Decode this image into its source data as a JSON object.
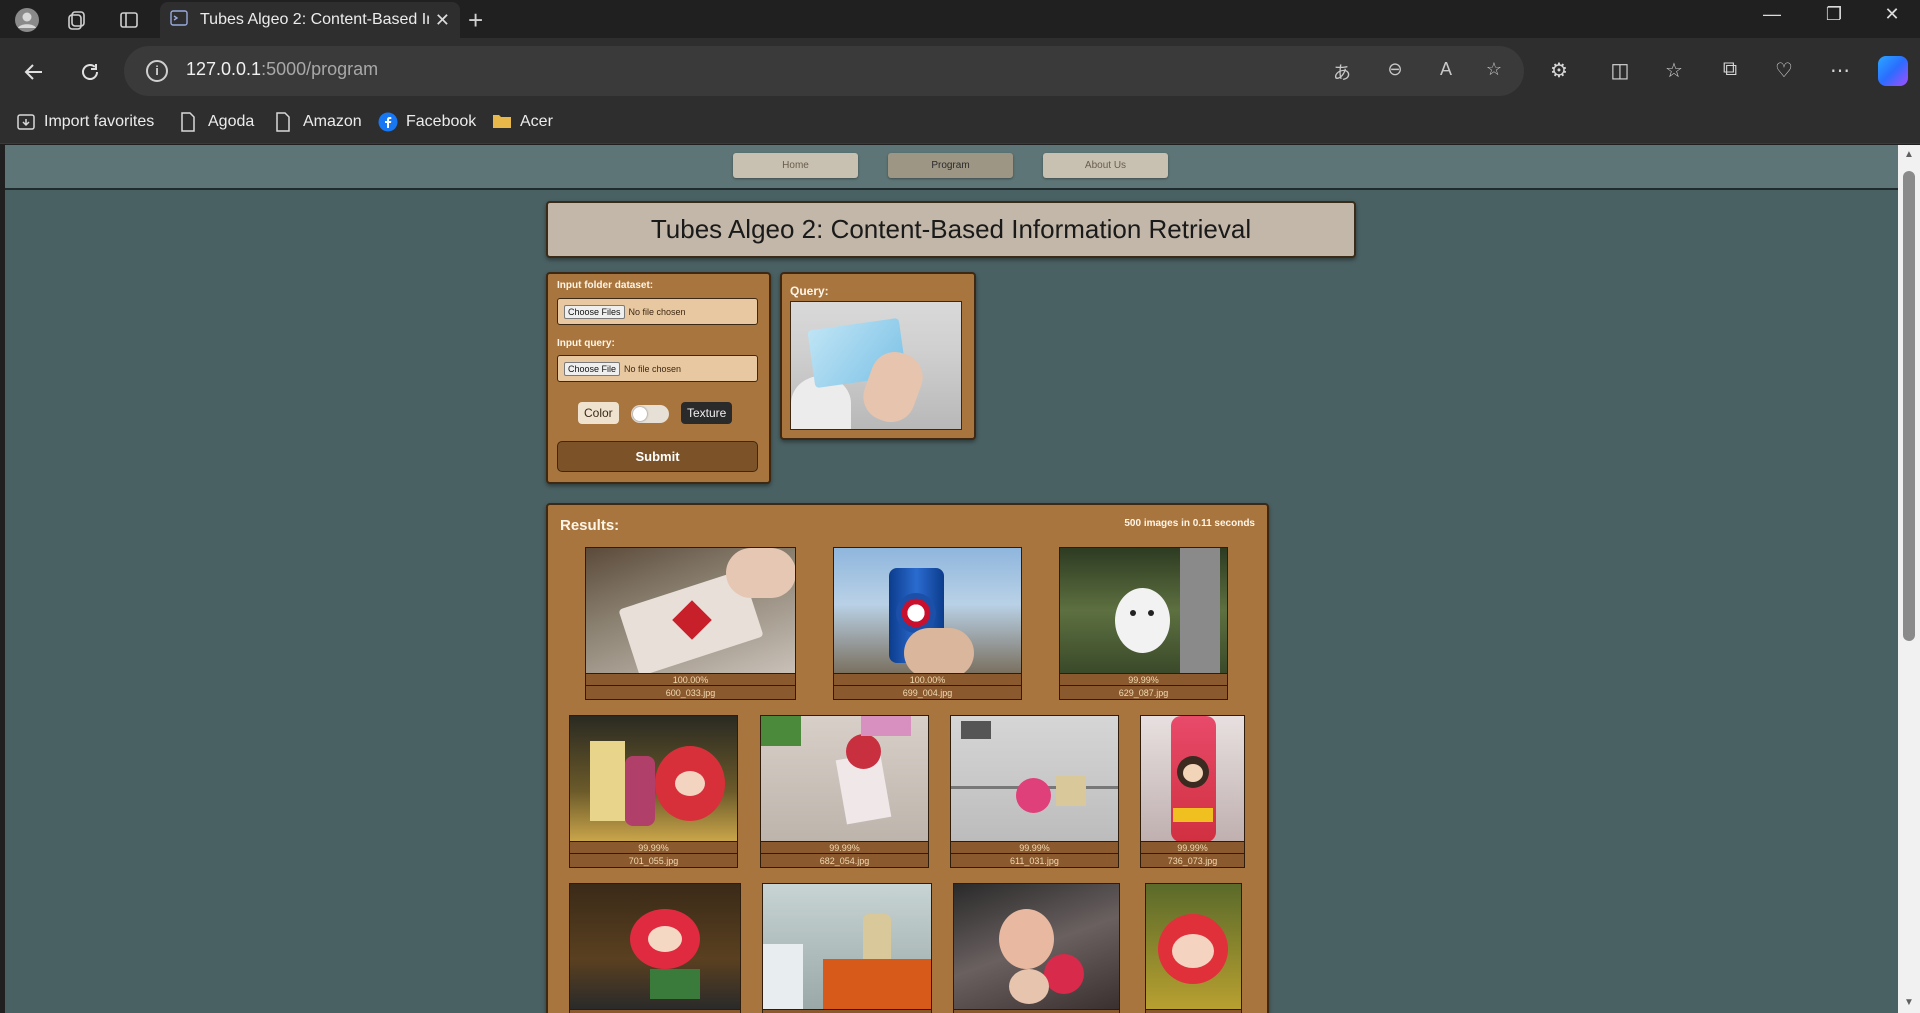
{
  "browser": {
    "tab_title": "Tubes Algeo 2: Content-Based In",
    "url_host": "127.0.0.1",
    "url_path": ":5000/program",
    "bookmarks": [
      "Import favorites",
      "Agoda",
      "Amazon",
      "Facebook",
      "Acer"
    ]
  },
  "site": {
    "nav": [
      "Home",
      "Program",
      "About Us"
    ],
    "active_nav": "Program",
    "title": "Tubes Algeo 2: Content-Based Information Retrieval"
  },
  "form": {
    "dataset_label": "Input folder dataset:",
    "dataset_button": "Choose Files",
    "dataset_status": "No file chosen",
    "query_label": "Input query:",
    "query_button": "Choose File",
    "query_status": "No file chosen",
    "toggle_left": "Color",
    "toggle_right": "Texture",
    "toggle_state": "Color",
    "submit": "Submit"
  },
  "query": {
    "title": "Query:"
  },
  "results": {
    "title": "Results:",
    "meta": "500 images in 0.11 seconds",
    "items": [
      {
        "score": "100.00%",
        "file": "600_033.jpg"
      },
      {
        "score": "100.00%",
        "file": "699_004.jpg"
      },
      {
        "score": "99.99%",
        "file": "629_087.jpg"
      },
      {
        "score": "99.99%",
        "file": "701_055.jpg"
      },
      {
        "score": "99.99%",
        "file": "682_054.jpg"
      },
      {
        "score": "99.99%",
        "file": "611_031.jpg"
      },
      {
        "score": "99.99%",
        "file": "736_073.jpg"
      }
    ]
  },
  "icons": {
    "profile": "profile-icon",
    "workspaces": "workspaces-icon",
    "tab_actions": "tab-actions-icon",
    "back": "back-icon",
    "refresh": "refresh-icon",
    "info": "site-info-icon"
  }
}
